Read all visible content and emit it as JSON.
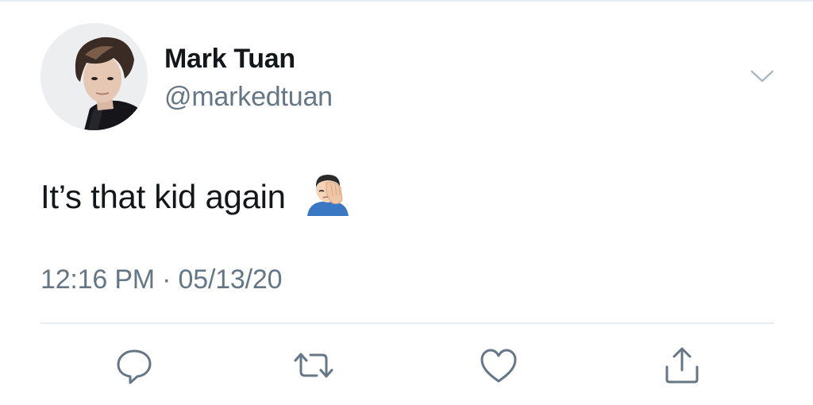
{
  "tweet": {
    "author": {
      "name": "Mark Tuan",
      "handle": "@markedtuan",
      "avatar_icon": "profile-photo"
    },
    "text": "It’s that kid again",
    "emoji": "face-palm-emoji",
    "timestamp": "12:16 PM · 05/13/20",
    "menu_icon": "chevron-down-icon",
    "actions": [
      {
        "name": "reply",
        "icon": "speech-bubble-icon"
      },
      {
        "name": "retweet",
        "icon": "retweet-arrows-icon"
      },
      {
        "name": "like",
        "icon": "heart-icon"
      },
      {
        "name": "share",
        "icon": "share-upload-icon"
      }
    ]
  },
  "colors": {
    "text_primary": "#14171a",
    "text_secondary": "#657786",
    "divider": "#e6ecf0",
    "background": "#ffffff"
  }
}
